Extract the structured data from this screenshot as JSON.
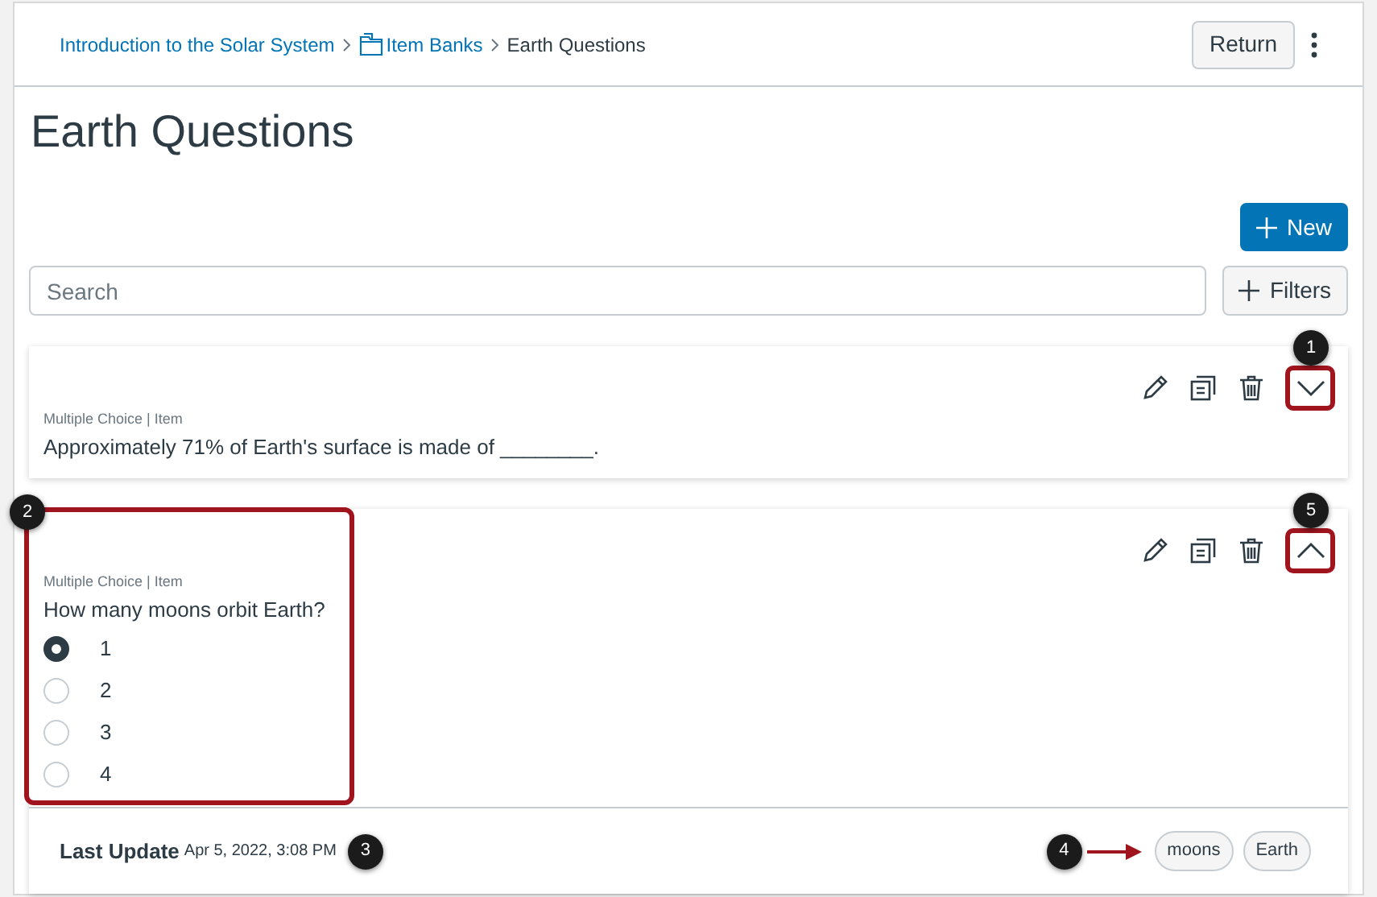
{
  "breadcrumb": [
    {
      "label": "Introduction to the Solar System",
      "kind": "link"
    },
    {
      "label": "Item Banks",
      "kind": "bank"
    },
    {
      "label": "Earth Questions",
      "kind": "current"
    }
  ],
  "header": {
    "return_button": "Return"
  },
  "title": "Earth Questions",
  "new_button": "New",
  "search": {
    "placeholder": "Search"
  },
  "filters_button": "Filters",
  "questions": [
    {
      "meta": "Multiple Choice | Item",
      "text": "Approximately 71% of Earth's surface is made of ________.",
      "expanded": false,
      "toggle_callout": "1"
    },
    {
      "meta": "Multiple Choice | Item",
      "text": "How many moons orbit Earth?",
      "expanded": true,
      "toggle_callout": "5",
      "answers_callout": "2",
      "answers": [
        {
          "label": "1",
          "selected": true
        },
        {
          "label": "2",
          "selected": false
        },
        {
          "label": "3",
          "selected": false
        },
        {
          "label": "4",
          "selected": false
        }
      ],
      "last_update_label": "Last Update",
      "last_update": "Apr 5, 2022, 3:08 PM",
      "last_update_callout": "3",
      "tags_callout": "4",
      "tags": [
        "moons",
        "Earth"
      ]
    }
  ]
}
